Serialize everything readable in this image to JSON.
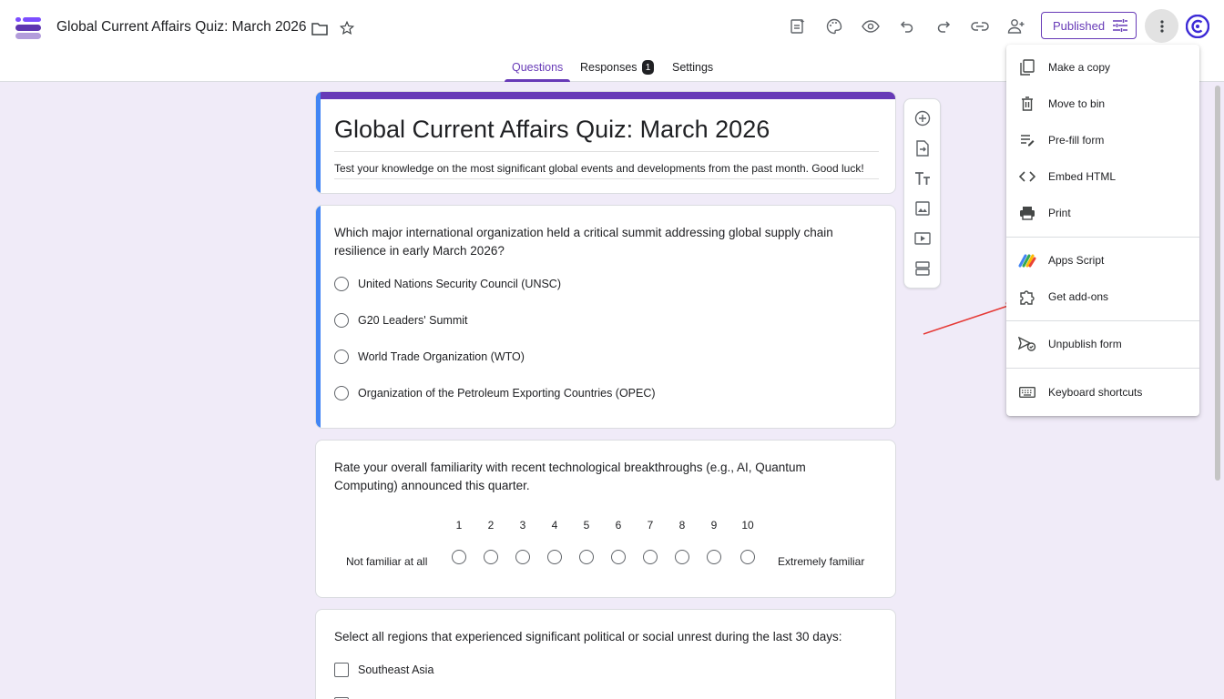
{
  "header": {
    "title": "Global Current Affairs Quiz: March 2026",
    "published_label": "Published"
  },
  "tabs": [
    {
      "label": "Questions",
      "active": true
    },
    {
      "label": "Responses",
      "badge": "1"
    },
    {
      "label": "Settings"
    }
  ],
  "form": {
    "title": "Global Current Affairs Quiz: March 2026",
    "description": "Test your knowledge on the most significant global events and developments from the past month. Good luck!"
  },
  "questions": [
    {
      "type": "multiple-choice",
      "text": "Which major international organization held a critical summit addressing global supply chain resilience in early March 2026?",
      "options": [
        "United Nations Security Council (UNSC)",
        "G20 Leaders' Summit",
        "World Trade Organization (WTO)",
        "Organization of the Petroleum Exporting Countries (OPEC)"
      ]
    },
    {
      "type": "linear-scale",
      "text": "Rate your overall familiarity with recent technological breakthroughs (e.g., AI, Quantum Computing) announced this quarter.",
      "scale": [
        "1",
        "2",
        "3",
        "4",
        "5",
        "6",
        "7",
        "8",
        "9",
        "10"
      ],
      "low_label": "Not familiar at all",
      "high_label": "Extremely familiar"
    },
    {
      "type": "checkboxes",
      "text": "Select all regions that experienced significant political or social unrest during the last 30 days:",
      "options": [
        "Southeast Asia"
      ]
    }
  ],
  "menu": {
    "items": [
      {
        "label": "Make a copy",
        "icon": "copy-icon"
      },
      {
        "label": "Move to bin",
        "icon": "trash-icon"
      },
      {
        "label": "Pre-fill form",
        "icon": "prefill-icon"
      },
      {
        "label": "Embed HTML",
        "icon": "code-icon"
      },
      {
        "label": "Print",
        "icon": "print-icon"
      },
      {
        "label": "Apps Script",
        "icon": "apps-script-icon"
      },
      {
        "label": "Get add-ons",
        "icon": "puzzle-icon"
      },
      {
        "label": "Unpublish form",
        "icon": "unpublish-icon"
      },
      {
        "label": "Keyboard shortcuts",
        "icon": "keyboard-icon"
      }
    ]
  },
  "colors": {
    "accent": "#673ab7",
    "background": "#f0ebf8",
    "question_highlight": "#4285f4",
    "annotation_arrow": "#e53935"
  }
}
